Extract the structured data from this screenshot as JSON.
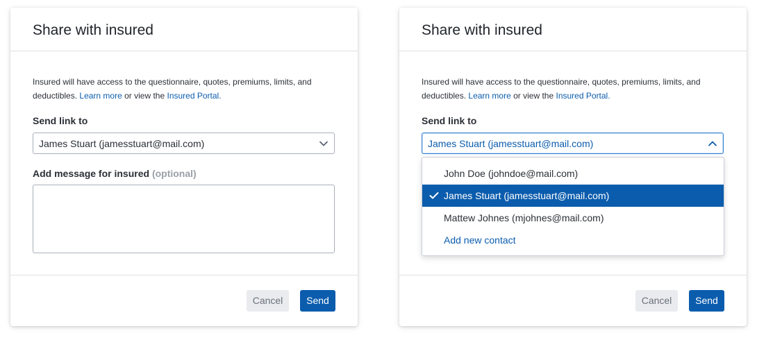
{
  "left_modal": {
    "title": "Share with insured",
    "description_text": "Insured will have access to the questionnaire, quotes, premiums, limits, and deductibles.",
    "learn_more_link": "Learn more",
    "or_view_text": "or view the",
    "portal_link": "Insured Portal.",
    "send_link_label": "Send link to",
    "selected_contact": "James Stuart (jamesstuart@mail.com)",
    "message_label": "Add message for insured",
    "optional_hint": "(optional)",
    "message_value": "",
    "cancel_label": "Cancel",
    "send_label": "Send"
  },
  "right_modal": {
    "title": "Share with insured",
    "description_text": "Insured will have access to the questionnaire, quotes, premiums, limits, and deductibles.",
    "learn_more_link": "Learn more",
    "or_view_text": "or view the",
    "portal_link": "Insured Portal.",
    "send_link_label": "Send link to",
    "selected_contact": "James Stuart (jamesstuart@mail.com)",
    "options": [
      "John Doe (johndoe@mail.com)",
      "James Stuart (jamesstuart@mail.com)",
      "Mattew Johnes (mjohnes@mail.com)"
    ],
    "selected_index": 1,
    "add_contact_label": "Add new contact",
    "cancel_label": "Cancel",
    "send_label": "Send"
  },
  "colors": {
    "primary": "#0b5cad",
    "cancel_bg": "#e9ebef",
    "border": "#a9afb8"
  }
}
